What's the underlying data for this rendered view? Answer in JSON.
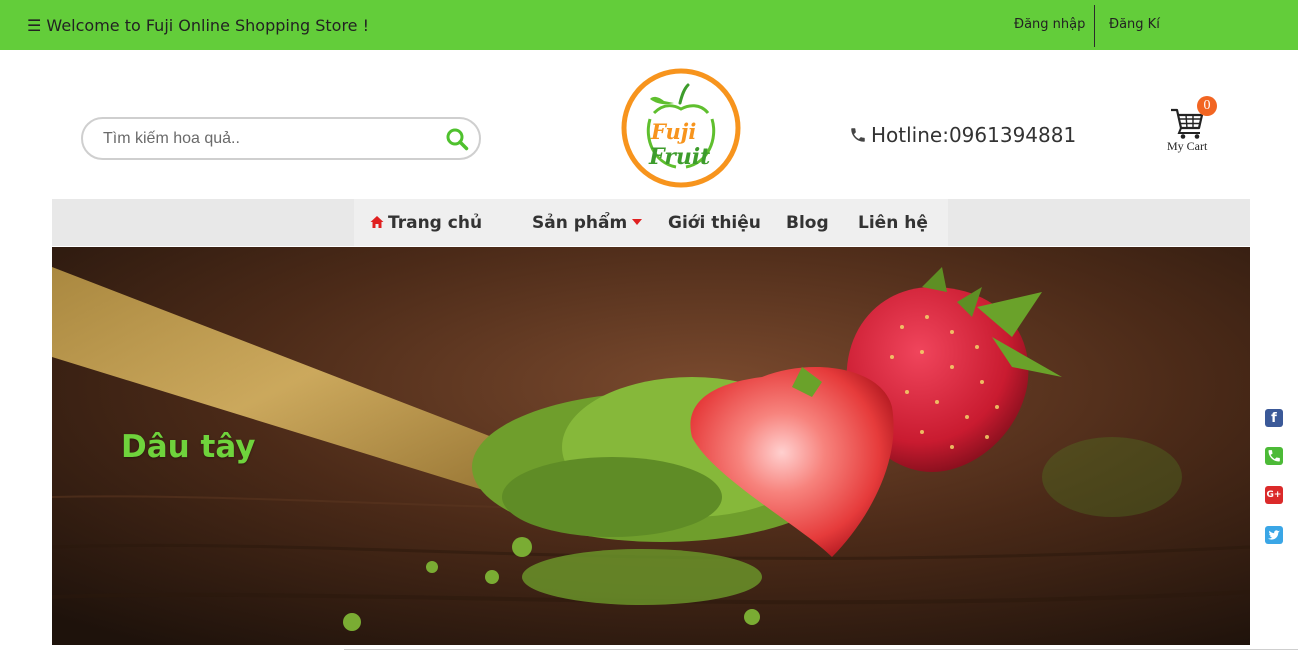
{
  "topbar": {
    "welcome": "☰ Welcome to Fuji Online Shopping Store !",
    "login": "Đăng nhập",
    "register": "Đăng Kí",
    "background": "#63cd3a"
  },
  "search": {
    "placeholder": "Tìm kiếm hoa quả..",
    "icon": "search-icon"
  },
  "logo": {
    "line1": "Fuji",
    "line2": "Fruit",
    "ring_color": "#f7941d",
    "text_color": "#3d9c2c"
  },
  "hotline": {
    "text": "Hotline:0961394881",
    "icon": "phone-icon"
  },
  "cart": {
    "count": "0",
    "label": "My Cart",
    "icon": "cart-icon"
  },
  "nav": {
    "items": [
      {
        "label": "Trang chủ",
        "icon": "home-icon"
      },
      {
        "label": "Sản phẩm",
        "icon": "caret-down-icon"
      },
      {
        "label": "Giới thiệu"
      },
      {
        "label": "Blog"
      },
      {
        "label": "Liên hệ"
      }
    ]
  },
  "banner": {
    "title": "Dâu tây",
    "title_color": "#6fd33c"
  },
  "social": {
    "items": [
      "facebook-icon",
      "phone-icon",
      "google-plus-icon",
      "twitter-icon"
    ]
  }
}
